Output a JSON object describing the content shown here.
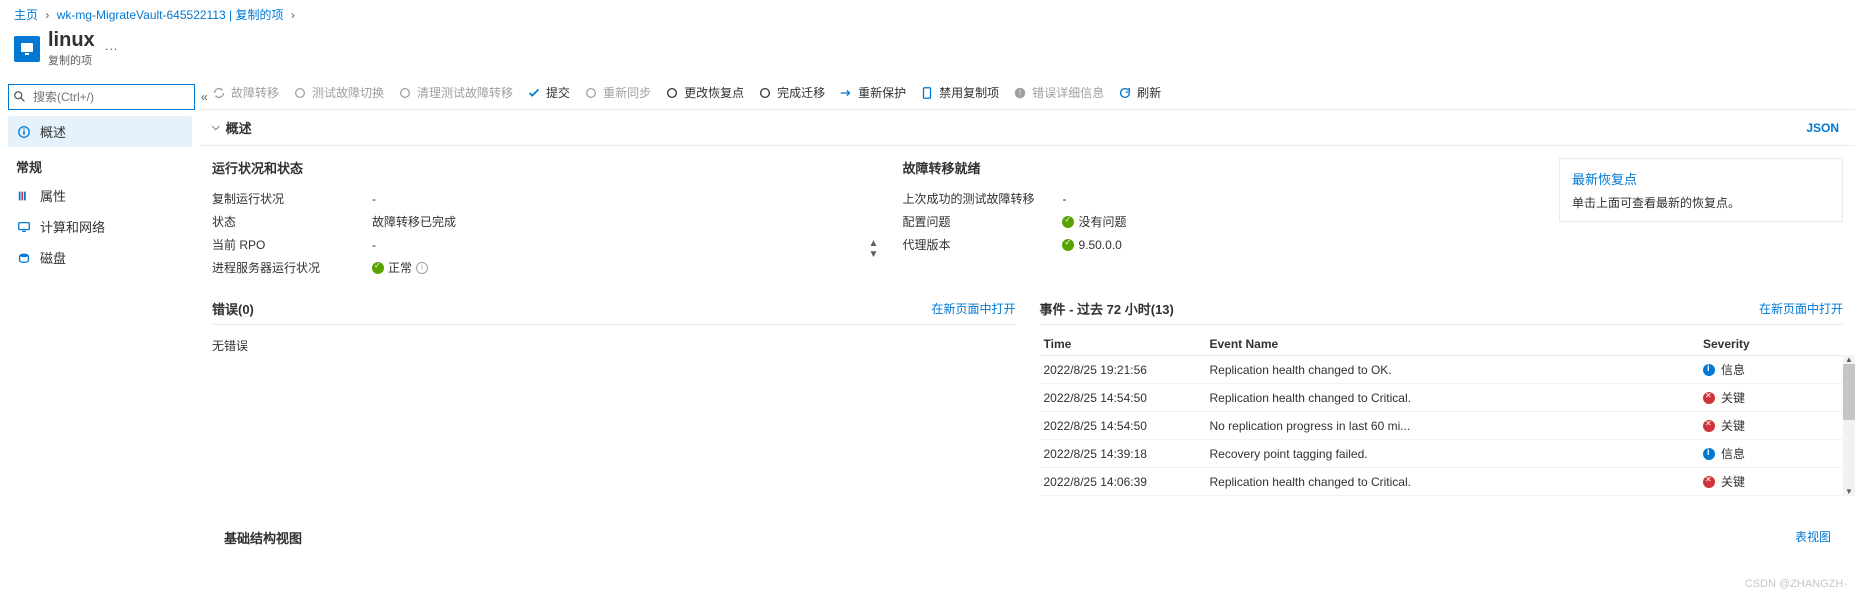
{
  "breadcrumb": {
    "items": [
      "主页",
      "wk-mg-MigrateVault-645522113 | 复制的项"
    ]
  },
  "header": {
    "title": "linux",
    "subtitle": "复制的项",
    "more": "···"
  },
  "search": {
    "placeholder": "搜索(Ctrl+/)",
    "collapse": "«"
  },
  "nav": {
    "overview": "概述",
    "group1": "常规",
    "properties": "属性",
    "compute": "计算和网络",
    "disks": "磁盘"
  },
  "toolbar": {
    "items": [
      {
        "label": "故障转移",
        "disabled": true,
        "icon": "failover"
      },
      {
        "label": "测试故障切换",
        "disabled": true,
        "icon": "test-failover"
      },
      {
        "label": "清理测试故障转移",
        "disabled": true,
        "icon": "cleanup"
      },
      {
        "label": "提交",
        "disabled": false,
        "icon": "commit"
      },
      {
        "label": "重新同步",
        "disabled": true,
        "icon": "resync"
      },
      {
        "label": "更改恢复点",
        "disabled": false,
        "icon": "change-rp"
      },
      {
        "label": "完成迁移",
        "disabled": false,
        "icon": "complete"
      },
      {
        "label": "重新保护",
        "disabled": false,
        "icon": "reprotect"
      },
      {
        "label": "禁用复制项",
        "disabled": false,
        "icon": "disable"
      },
      {
        "label": "错误详细信息",
        "disabled": true,
        "icon": "error"
      },
      {
        "label": "刷新",
        "disabled": false,
        "icon": "refresh"
      }
    ]
  },
  "overview_section": {
    "title": "概述",
    "json_link": "JSON"
  },
  "health": {
    "title_left": "运行状况和状态",
    "title_right": "故障转移就绪",
    "left": [
      {
        "k": "复制运行状况",
        "v": "-"
      },
      {
        "k": "状态",
        "v": "故障转移已完成"
      },
      {
        "k": "当前 RPO",
        "v": "-"
      },
      {
        "k": "进程服务器运行状况",
        "v": "正常",
        "status": "ok",
        "info": true
      }
    ],
    "right": [
      {
        "k": "上次成功的测试故障转移",
        "v": "-"
      },
      {
        "k": "配置问题",
        "v": "没有问题",
        "status": "ok"
      },
      {
        "k": "代理版本",
        "v": "9.50.0.0",
        "status": "ok"
      }
    ]
  },
  "recovery_box": {
    "title": "最新恢复点",
    "text": "单击上面可查看最新的恢复点。"
  },
  "errors_panel": {
    "title": "错误(0)",
    "link": "在新页面中打开",
    "empty": "无错误"
  },
  "events_panel": {
    "title": "事件 - 过去 72 小时(13)",
    "link": "在新页面中打开",
    "columns": {
      "c1": "Time",
      "c2": "Event Name",
      "c3": "Severity"
    },
    "rows": [
      {
        "t": "2022/8/25 19:21:56",
        "n": "Replication health changed to OK.",
        "s": "信息",
        "icon": "info"
      },
      {
        "t": "2022/8/25 14:54:50",
        "n": "Replication health changed to Critical.",
        "s": "关键",
        "icon": "crit"
      },
      {
        "t": "2022/8/25 14:54:50",
        "n": "No replication progress in last 60 mi...",
        "s": "关键",
        "icon": "crit"
      },
      {
        "t": "2022/8/25 14:39:18",
        "n": "Recovery point tagging failed.",
        "s": "信息",
        "icon": "info"
      },
      {
        "t": "2022/8/25 14:06:39",
        "n": "Replication health changed to Critical.",
        "s": "关键",
        "icon": "crit"
      }
    ]
  },
  "footer": {
    "title": "基础结构视图",
    "link": "表视图"
  },
  "watermark": "CSDN @ZHANGZH-"
}
